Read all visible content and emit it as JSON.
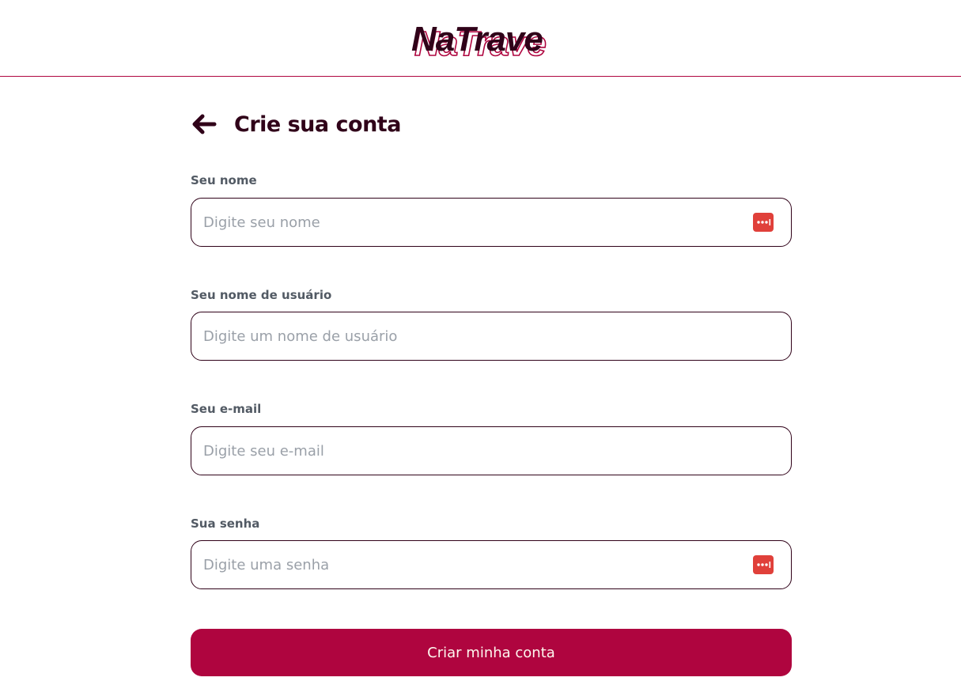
{
  "header": {
    "logo_text": "NaTrave"
  },
  "form": {
    "title": "Crie sua conta",
    "fields": [
      {
        "label": "Seu nome",
        "placeholder": "Digite seu nome",
        "value": "",
        "has_password_manager_icon": true
      },
      {
        "label": "Seu nome de usuário",
        "placeholder": "Digite um nome de usuário",
        "value": "",
        "has_password_manager_icon": false
      },
      {
        "label": "Seu e-mail",
        "placeholder": "Digite seu e-mail",
        "value": "",
        "has_password_manager_icon": false
      },
      {
        "label": "Sua senha",
        "placeholder": "Digite uma senha",
        "value": "",
        "has_password_manager_icon": true
      }
    ],
    "submit_label": "Criar minha conta"
  },
  "icons": {
    "back": "arrow-left-icon",
    "password_manager": "password-manager-icon"
  },
  "colors": {
    "brand_red": "#af053f",
    "brand_dark": "#300219",
    "label_gray": "#525a64",
    "placeholder_gray": "#9aa0a8",
    "pm_icon_red": "#e0403a",
    "button_text": "#fef8ef"
  }
}
